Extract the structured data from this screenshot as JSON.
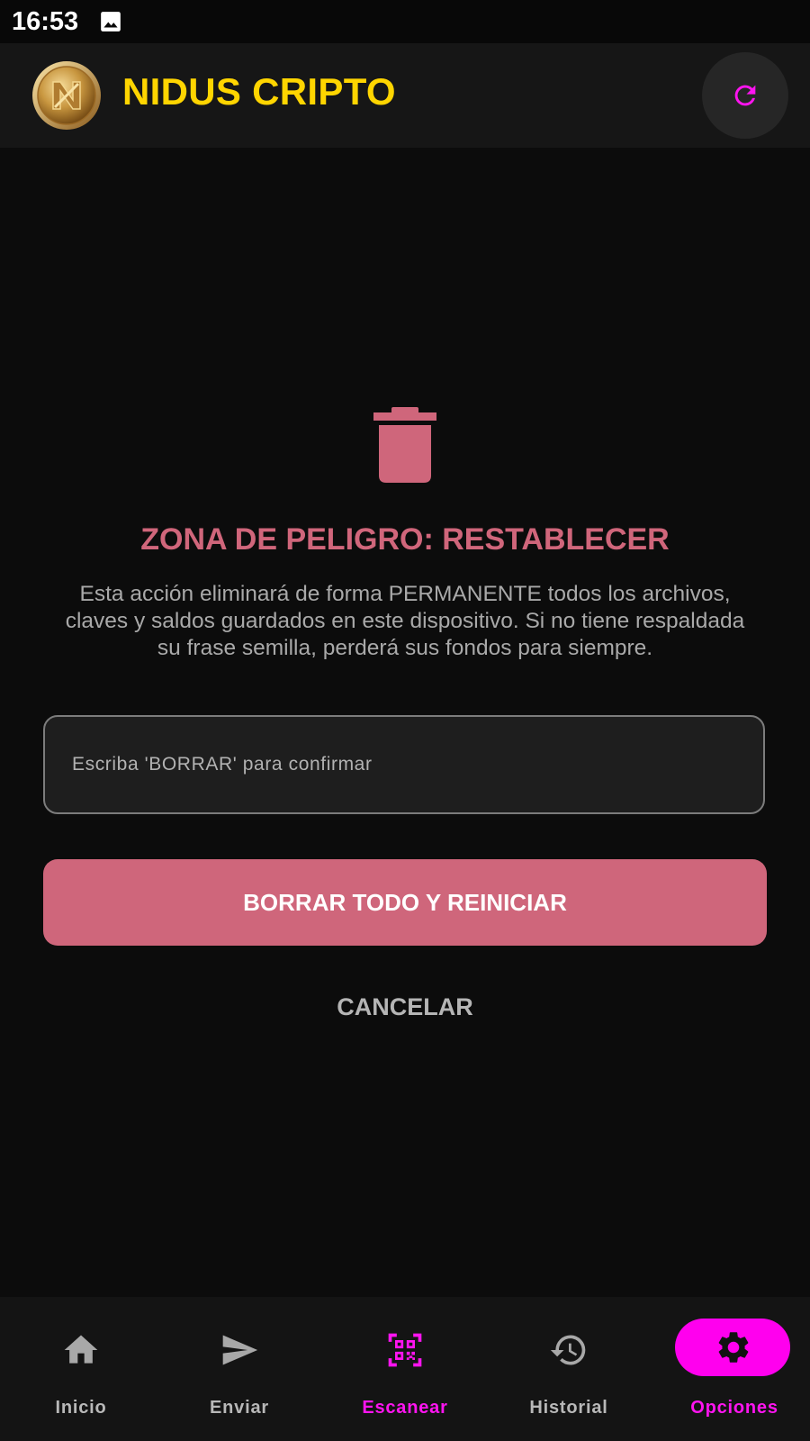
{
  "status_bar": {
    "time": "16:53",
    "icons": [
      "image-icon"
    ]
  },
  "header": {
    "title": "NIDUS CRIPTO",
    "logo": "nidus-coin-logo",
    "refresh_icon": "refresh-icon"
  },
  "main": {
    "icon": "trash-icon",
    "title": "ZONA DE PELIGRO: RESTABLECER",
    "description_lines": [
      "Esta acción eliminará de forma PERMANENTE todos los archivos,",
      "claves y saldos guardados en este dispositivo. Si no tiene respaldada",
      "su frase semilla, perderá sus fondos para siempre."
    ],
    "confirm_input": {
      "value": "",
      "placeholder": "Escriba 'BORRAR' para confirmar"
    },
    "reset_button_label": "BORRAR TODO Y REINICIAR",
    "cancel_button_label": "CANCELAR"
  },
  "bottom_nav": {
    "items": [
      {
        "label": "Inicio",
        "icon": "home-icon",
        "active": false
      },
      {
        "label": "Enviar",
        "icon": "send-icon",
        "active": false
      },
      {
        "label": "Escanear",
        "icon": "qr-scan-icon",
        "active": false
      },
      {
        "label": "Historial",
        "icon": "history-icon",
        "active": false
      },
      {
        "label": "Opciones",
        "icon": "settings-icon",
        "active": true
      }
    ]
  },
  "colors": {
    "background": "#0c0c0c",
    "header_background": "#161616",
    "brand_yellow": "#ffd500",
    "danger": "#cf667b",
    "accent_magenta": "#ff00ee",
    "muted_text": "#a9a9a9"
  }
}
